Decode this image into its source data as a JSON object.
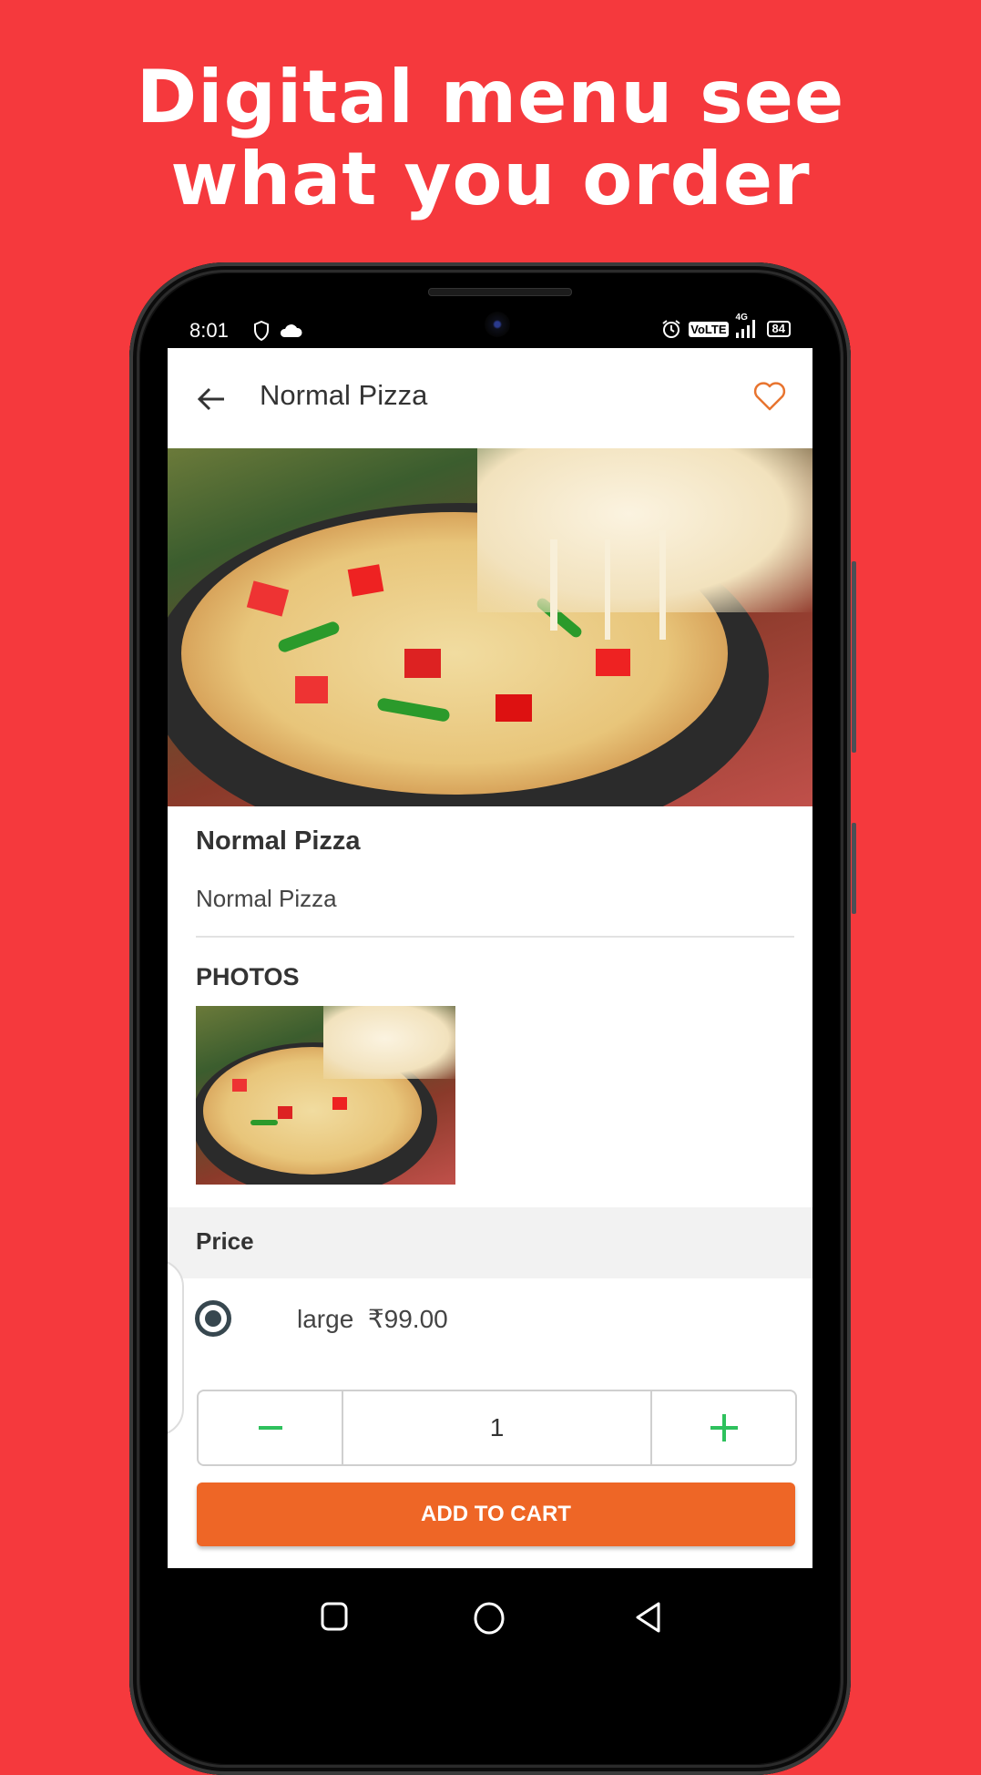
{
  "promo": {
    "headline_line1": "Digital menu see",
    "headline_line2": "what you order",
    "background_color": "#f5393d"
  },
  "status_bar": {
    "time": "8:01",
    "left_icons": [
      "shield-icon",
      "cloud-icon"
    ],
    "right_icons": [
      "alarm-icon",
      "volte-badge",
      "signal-4g-icon",
      "battery-icon"
    ],
    "volte_label": "VoLTE",
    "network_label": "4G",
    "battery_level": "84"
  },
  "app_bar": {
    "back_icon": "arrow-left-icon",
    "title": "Normal Pizza",
    "favorite_icon": "heart-outline-icon",
    "accent_color": "#e8742f"
  },
  "product": {
    "hero_image": "pizza-photo",
    "name": "Normal Pizza",
    "description": "Normal  Pizza",
    "photos_label": "PHOTOS",
    "photos": [
      "pizza-thumbnail"
    ]
  },
  "price_section": {
    "label": "Price",
    "options": [
      {
        "size": "large",
        "price": "₹99.00",
        "selected": true
      }
    ]
  },
  "quantity": {
    "decrement_label": "−",
    "value": "1",
    "increment_label": "+",
    "control_color": "#2ec15d"
  },
  "cart_button": {
    "label": "ADD TO CART",
    "color": "#ee6626"
  },
  "nav_bar": {
    "buttons": [
      "recents-icon",
      "home-icon",
      "back-icon"
    ]
  }
}
